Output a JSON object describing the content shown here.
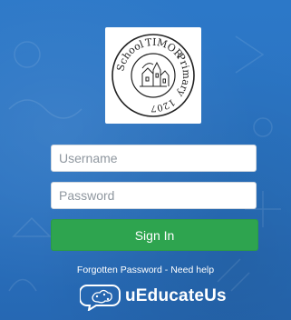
{
  "school_logo": {
    "ring_text_top": "TIMOR",
    "ring_text_right": "Primary",
    "ring_text_left": "School",
    "ring_text_bottom": "1207"
  },
  "login": {
    "username_placeholder": "Username",
    "password_placeholder": "Password",
    "signin_label": "Sign In"
  },
  "links": {
    "forgotten_password": "Forgotten Password",
    "separator": " - ",
    "need_help": "Need help"
  },
  "brand": {
    "name": "uEducateUs",
    "icon": "speech-bubble-brain-icon"
  },
  "colors": {
    "background": "#2a74c3",
    "signin_button": "#2ea44f"
  }
}
